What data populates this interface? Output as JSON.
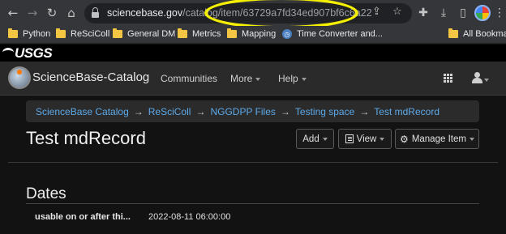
{
  "browser": {
    "url_host": "sciencebase.gov",
    "url_path": "/catalog/item/63729a7fd34ed907bf6c6a22",
    "highlight_color": "#f5f000"
  },
  "bookmarks": {
    "items": [
      {
        "label": "Python",
        "icon": "folder-icon"
      },
      {
        "label": "ReSciColl",
        "icon": "folder-icon"
      },
      {
        "label": "General DM",
        "icon": "folder-icon"
      },
      {
        "label": "Metrics",
        "icon": "folder-icon"
      },
      {
        "label": "Mapping",
        "icon": "folder-icon"
      },
      {
        "label": "Time Converter and...",
        "icon": "clock-icon"
      }
    ],
    "all_bookmarks": "All Bookmarks"
  },
  "usgs": {
    "logo_text": "USGS"
  },
  "navbar": {
    "brand": "ScienceBase-Catalog",
    "communities": "Communities",
    "more": "More",
    "help": "Help"
  },
  "breadcrumb": {
    "items": [
      "ScienceBase Catalog",
      "ReSciColl",
      "NGGDPP Files",
      "Testing space",
      "Test mdRecord"
    ],
    "separator": "→",
    "link_color": "#5da9e9"
  },
  "page": {
    "title": "Test mdRecord",
    "buttons": {
      "add": "Add",
      "view": "View",
      "manage": "Manage Item"
    }
  },
  "dates": {
    "heading": "Dates",
    "rows": [
      {
        "label": "usable on or after thi...",
        "value": "2022-08-11 06:00:00"
      }
    ]
  }
}
